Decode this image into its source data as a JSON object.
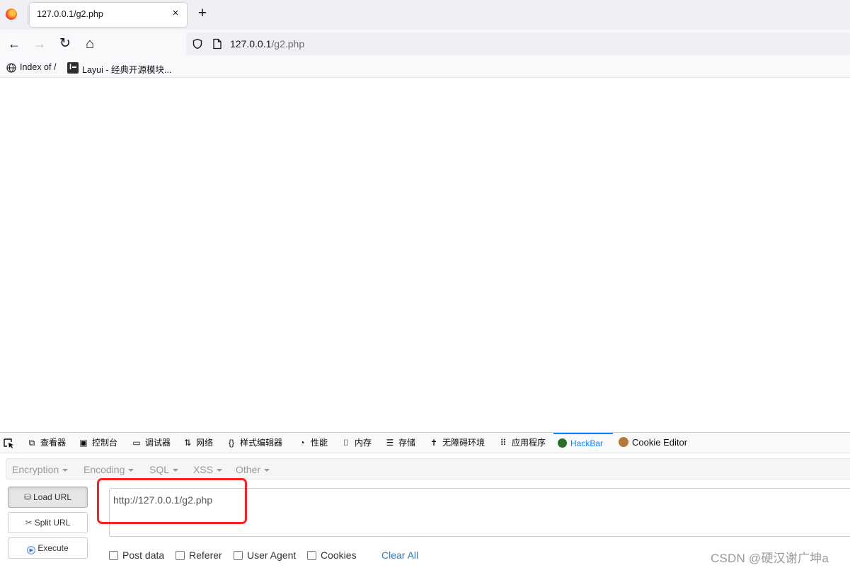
{
  "browser": {
    "tab": {
      "title": "127.0.0.1/g2.php",
      "close": "×"
    },
    "new_tab": "+",
    "nav": {
      "back": "←",
      "forward": "→",
      "reload": "↻",
      "home": "⌂"
    },
    "url": {
      "host": "127.0.0.1",
      "path": "/g2.php"
    },
    "bookmarks": [
      {
        "label": "Index of /",
        "icon": "globe-icon"
      },
      {
        "label": "Layui - 经典开源模块...",
        "icon": "layui-icon"
      }
    ]
  },
  "devtools": {
    "tabs": [
      {
        "label": "",
        "icon": "pick-element-icon"
      },
      {
        "label": "查看器",
        "icon": "inspector-icon"
      },
      {
        "label": "控制台",
        "icon": "console-icon"
      },
      {
        "label": "调试器",
        "icon": "debugger-icon"
      },
      {
        "label": "网络",
        "icon": "network-icon"
      },
      {
        "label": "样式编辑器",
        "icon": "style-editor-icon"
      },
      {
        "label": "性能",
        "icon": "performance-icon"
      },
      {
        "label": "内存",
        "icon": "memory-icon"
      },
      {
        "label": "存储",
        "icon": "storage-icon"
      },
      {
        "label": "无障碍环境",
        "icon": "accessibility-icon"
      },
      {
        "label": "应用程序",
        "icon": "application-icon"
      },
      {
        "label": "HackBar",
        "icon": "hackbar-icon"
      },
      {
        "label": "Cookie Editor",
        "icon": "cookie-icon"
      }
    ],
    "active_tab": "HackBar",
    "accent": "#0a84ff"
  },
  "hackbar": {
    "menus": [
      "Encryption",
      "Encoding",
      "SQL",
      "XSS",
      "Other"
    ],
    "buttons": {
      "load": "Load URL",
      "split": "Split URL",
      "execute": "Execute"
    },
    "url_value": "http://127.0.0.1/g2.php",
    "options": [
      "Post data",
      "Referer",
      "User Agent",
      "Cookies"
    ],
    "clear_all": "Clear All",
    "highlight_color": "#ff2121"
  },
  "watermark": "CSDN @硬汉谢广坤a"
}
